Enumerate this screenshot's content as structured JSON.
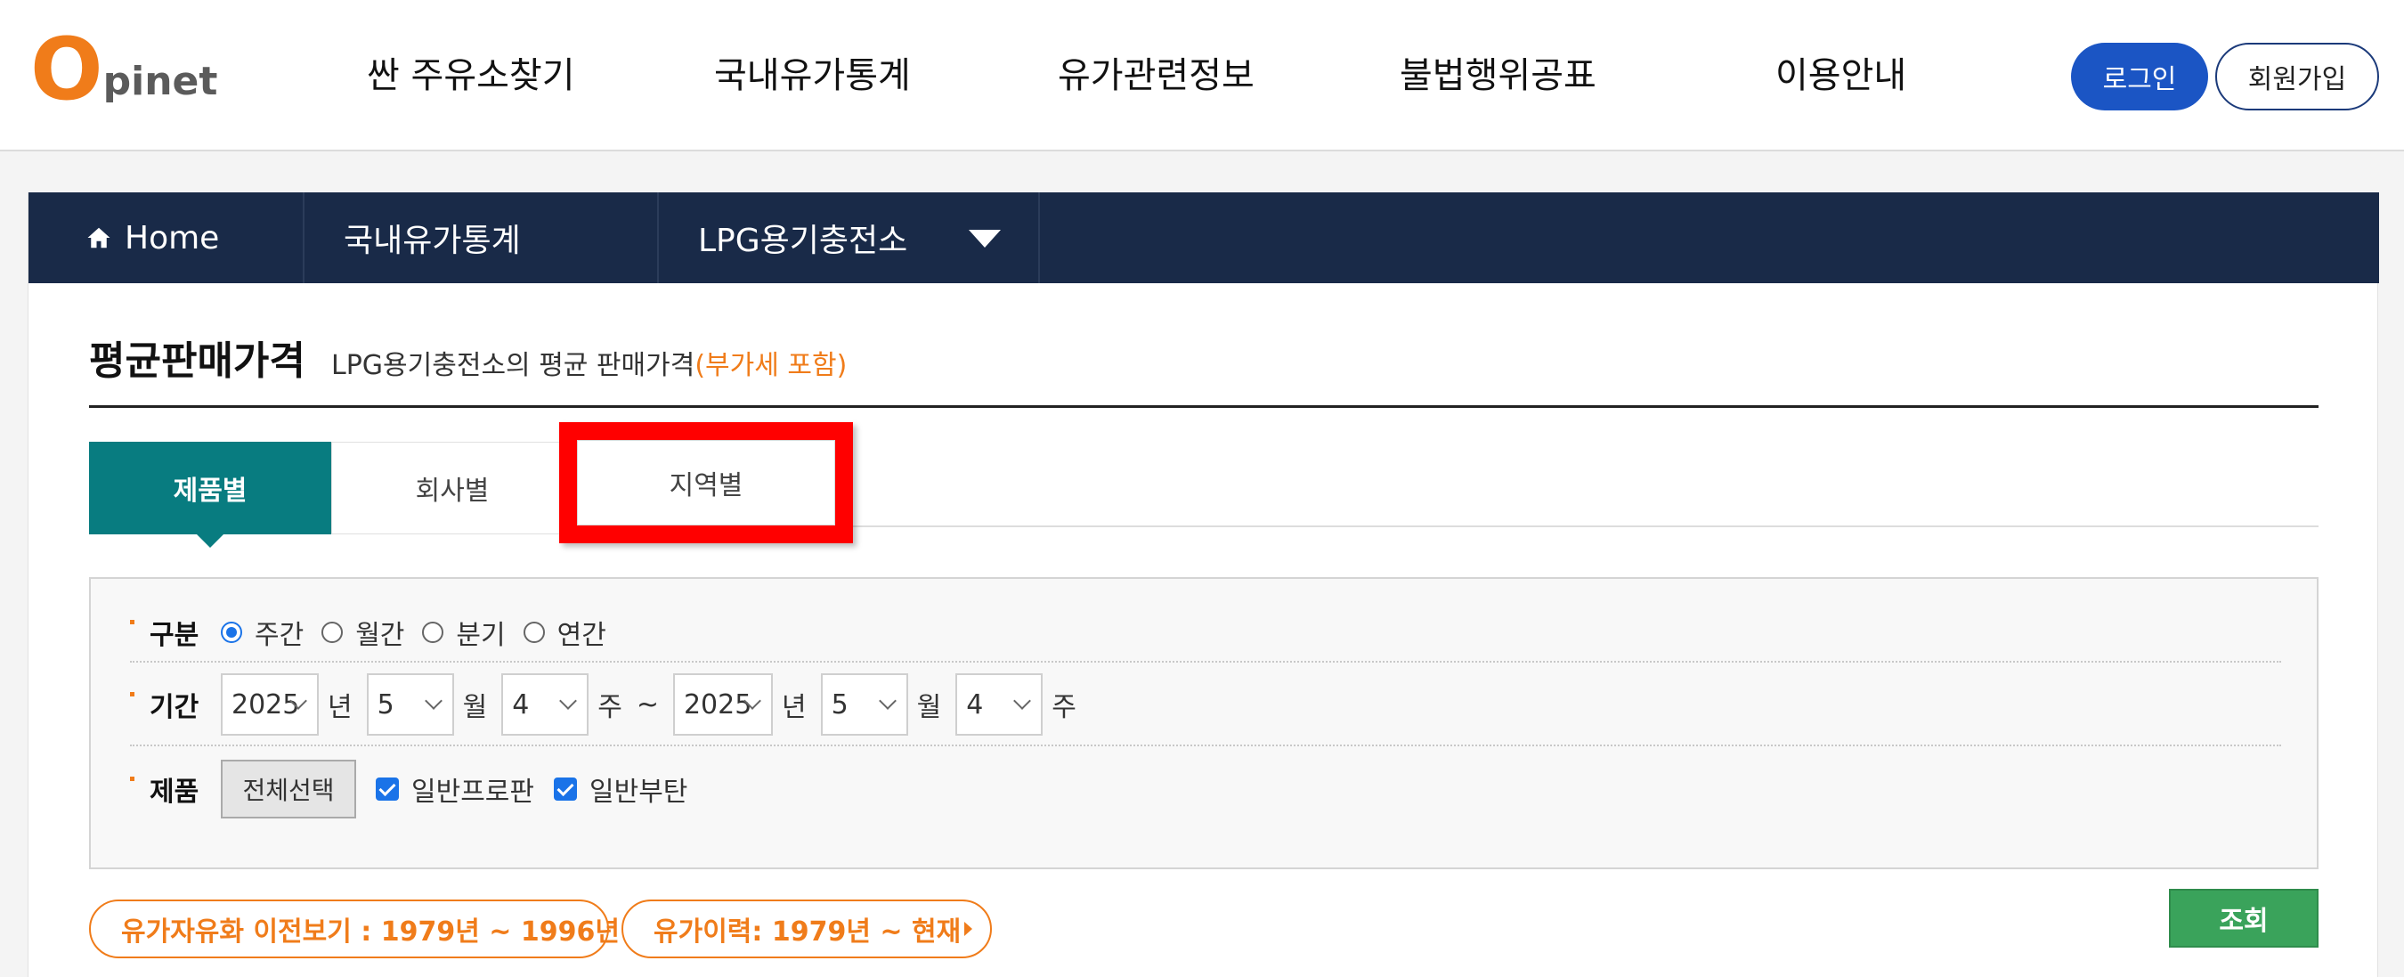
{
  "header": {
    "logo_o": "O",
    "logo_text": "pinet",
    "nav": [
      "싼 주유소찾기",
      "국내유가통계",
      "유가관련정보",
      "불법행위공표",
      "이용안내"
    ],
    "login_label": "로그인",
    "join_label": "회원가입"
  },
  "breadcrumb": {
    "home_label": "Home",
    "level1": "국내유가통계",
    "level2": "LPG용기충전소"
  },
  "page": {
    "title": "평균판매가격",
    "desc": "LPG용기충전소의 평균 판매가격",
    "vat_note": "(부가세 포함)"
  },
  "tabs": [
    {
      "label": "제품별",
      "active": true
    },
    {
      "label": "회사별",
      "active": false
    },
    {
      "label": "지역별",
      "active": false
    }
  ],
  "form": {
    "period_type_label": "구분",
    "period_types": [
      {
        "label": "주간",
        "checked": true
      },
      {
        "label": "월간",
        "checked": false
      },
      {
        "label": "분기",
        "checked": false
      },
      {
        "label": "연간",
        "checked": false
      }
    ],
    "date_label": "기간",
    "from": {
      "year": "2025",
      "month": "5",
      "week": "4"
    },
    "to": {
      "year": "2025",
      "month": "5",
      "week": "4"
    },
    "unit_year": "년",
    "unit_month": "월",
    "unit_week": "주",
    "tilde": "~",
    "product_label": "제품",
    "select_all_label": "전체선택",
    "products": [
      {
        "label": "일반프로판",
        "checked": true
      },
      {
        "label": "일반부탄",
        "checked": true
      }
    ]
  },
  "bottom": {
    "history_prev": "유가자유화 이전보기 : 1979년 ~ 1996년",
    "history": "유가이력: 1979년 ~ 현재",
    "search_label": "조회"
  },
  "colors": {
    "brand_orange": "#f07c1a",
    "nav_dark": "#192a48",
    "tab_active": "#087c80",
    "login_blue": "#1b55c4",
    "search_green": "#3aa35b",
    "highlight_red": "#ff0000"
  }
}
